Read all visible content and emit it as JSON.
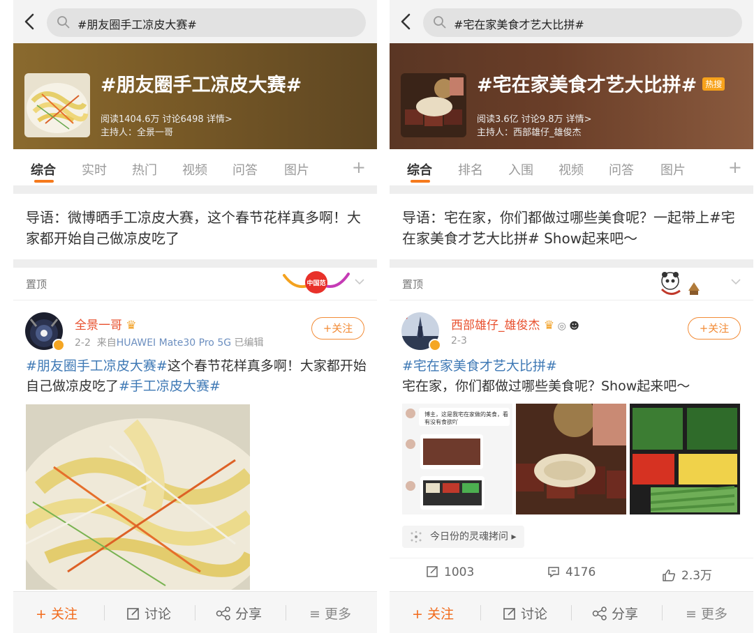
{
  "left": {
    "search": {
      "query": "#朋友圈手工凉皮大赛#"
    },
    "banner": {
      "title": "#朋友圈手工凉皮大赛#",
      "stats": "阅读1404.6万 讨论6498 详情>",
      "host": "主持人：全景一哥"
    },
    "tabs": [
      "综合",
      "实时",
      "热门",
      "视频",
      "问答",
      "图片"
    ],
    "tab_plus": "+",
    "intro": "导语：微博晒手工凉皮大赛，这个春节花样真多啊！大家都开始自己做凉皮吃了",
    "pinned": {
      "label": "置顶",
      "deco_text": "中国范"
    },
    "post": {
      "username": "全景一哥",
      "date": "2-2",
      "source_prefix": "来自",
      "device": "HUAWEI Mate30 Pro 5G",
      "edited": "已编辑",
      "follow": "+关注",
      "tag1": "#朋友圈手工凉皮大赛#",
      "body1": "这个春节花样真多啊！大家都开始自己做凉皮吃了",
      "tag2": "#手工凉皮大赛#"
    },
    "bottom": {
      "follow": "+ 关注",
      "discuss": "讨论",
      "share": "分享",
      "more": "≡ 更多"
    }
  },
  "right": {
    "search": {
      "query": "#宅在家美食才艺大比拼#"
    },
    "banner": {
      "title": "#宅在家美食才艺大比拼#",
      "badge": "热搜",
      "stats": "阅读3.6亿 讨论9.8万 详情>",
      "host": "主持人：西部雄仔_雄俊杰"
    },
    "tabs": [
      "综合",
      "排名",
      "入围",
      "视频",
      "问答",
      "图片"
    ],
    "tab_plus": "+",
    "intro": "导语：宅在家，你们都做过哪些美食呢？一起带上#宅在家美食才艺大比拼# Show起来吧～",
    "pinned": {
      "label": "置顶"
    },
    "post": {
      "username": "西部雄仔_雄俊杰",
      "date": "2-3",
      "follow": "+关注",
      "tag": "#宅在家美食才艺大比拼#",
      "body": "宅在家，你们都做过哪些美食呢？Show起来吧～",
      "chat_text": "博主，这是我宅在家做的美食，看有没有食欲吖",
      "location": "今日份的灵魂拷问 ▸"
    },
    "stats": {
      "repost": "1003",
      "comment": "4176",
      "like": "2.3万"
    },
    "bottom": {
      "follow": "+ 关注",
      "discuss": "讨论",
      "share": "分享",
      "more": "≡ 更多"
    }
  },
  "colors": {
    "accent": "#f57a1c",
    "link": "#3f79b5",
    "username": "#e8512f"
  }
}
